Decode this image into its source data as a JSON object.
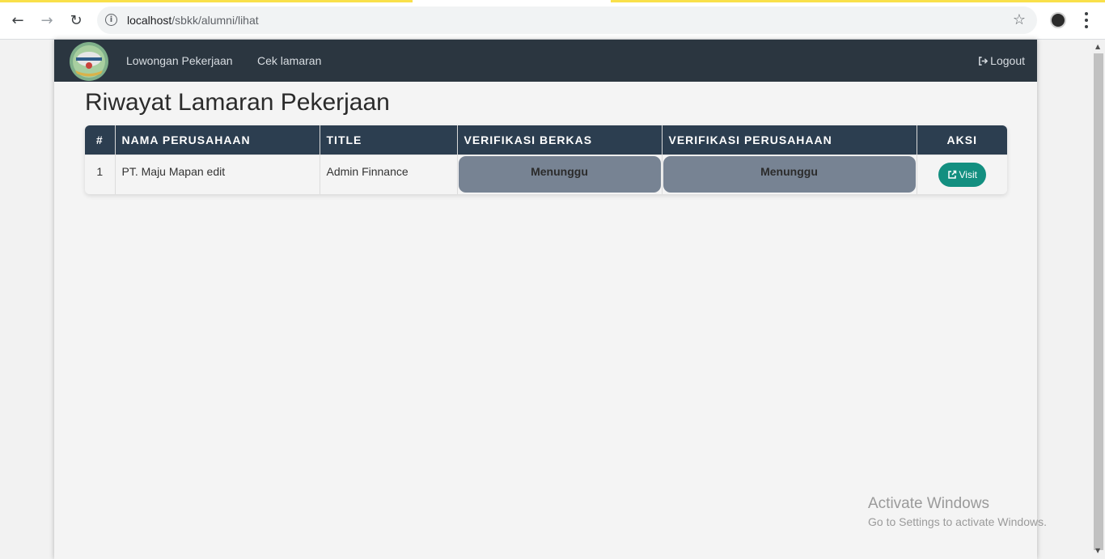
{
  "browser": {
    "url_host": "localhost",
    "url_path": "/sbkk/alumni/lihat"
  },
  "navbar": {
    "links": [
      "Lowongan Pekerjaan",
      "Cek lamaran"
    ],
    "logout_label": "Logout"
  },
  "page_title": "Riwayat Lamaran Pekerjaan",
  "table": {
    "headers": [
      "#",
      "NAMA PERUSAHAAN",
      "TITLE",
      "VERIFIKASI BERKAS",
      "VERIFIKASI PERUSAHAAN",
      "AKSI"
    ],
    "rows": [
      {
        "num": "1",
        "company": "PT. Maju Mapan edit",
        "title": "Admin Finnance",
        "verifikasi_berkas": "Menunggu",
        "verifikasi_perusahaan": "Menunggu",
        "action_label": "Visit"
      }
    ]
  },
  "watermark": {
    "line1": "Activate Windows",
    "line2": "Go to Settings to activate Windows."
  },
  "colors": {
    "navbar_bg": "#2b3640",
    "table_header_bg": "#2c3e50",
    "status_pill": "#778393",
    "visit_button": "#138f80"
  }
}
